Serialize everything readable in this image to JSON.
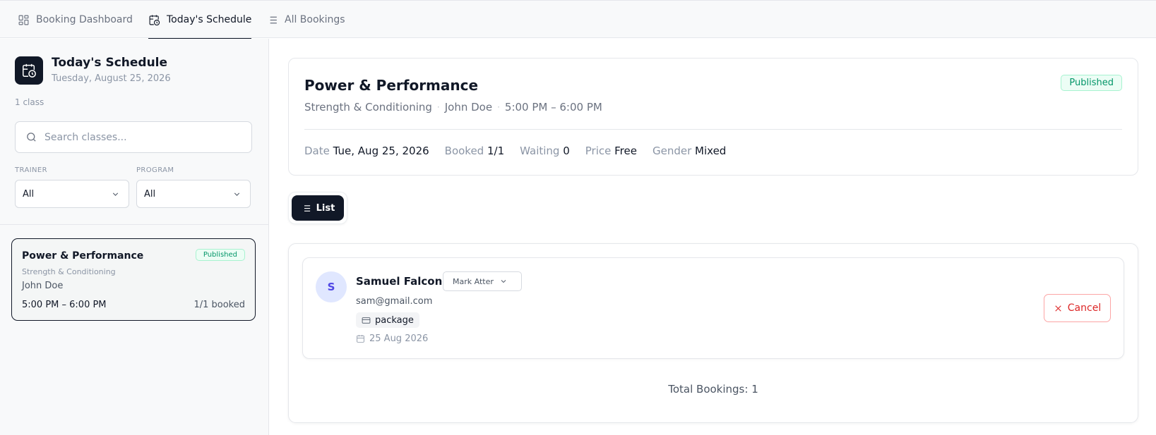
{
  "nav": {
    "tabs": [
      {
        "label": "Booking Dashboard",
        "icon": "dashboard-icon"
      },
      {
        "label": "Today's Schedule",
        "icon": "calendar-clock-icon"
      },
      {
        "label": "All Bookings",
        "icon": "list-icon"
      }
    ],
    "active_tab": "Today's Schedule"
  },
  "sidebar": {
    "title": "Today's Schedule",
    "date": "Tuesday, August 25, 2026",
    "count": "1 class",
    "search": {
      "placeholder": "Search classes...",
      "value": ""
    },
    "filters": {
      "trainer": {
        "label": "TRAINER",
        "value": "All"
      },
      "program": {
        "label": "PROGRAM",
        "value": "All"
      }
    },
    "classes": [
      {
        "title": "Power & Performance",
        "status": "Published",
        "program": "Strength & Conditioning",
        "trainer": "John Doe",
        "time": "5:00 PM – 6:00 PM",
        "booked": "1/1 booked"
      }
    ]
  },
  "class_detail": {
    "title": "Power & Performance",
    "status": "Published",
    "program": "Strength & Conditioning",
    "trainer": "John Doe",
    "time": "5:00 PM – 6:00 PM",
    "meta": {
      "date_label": "Date",
      "date_value": "Tue, Aug 25, 2026",
      "booked_label": "Booked",
      "booked_value": "1/1",
      "waiting_label": "Waiting",
      "waiting_value": "0",
      "price_label": "Price",
      "price_value": "Free",
      "gender_label": "Gender",
      "gender_value": "Mixed"
    }
  },
  "view_toggle": {
    "label": "List"
  },
  "bookings": [
    {
      "initial": "S",
      "name": "Samuel Falcone",
      "attendance_placeholder": "Mark Attendance",
      "email": "sam@gmail.com",
      "type": "package",
      "date": "25 Aug 2026",
      "cancel_label": "Cancel"
    }
  ],
  "total_bookings": "Total Bookings: 1",
  "colors": {
    "primary_dark": "#111827",
    "published_green": "#059669",
    "cancel_red": "#dc2626",
    "avatar_bg": "#e0e7ff"
  }
}
